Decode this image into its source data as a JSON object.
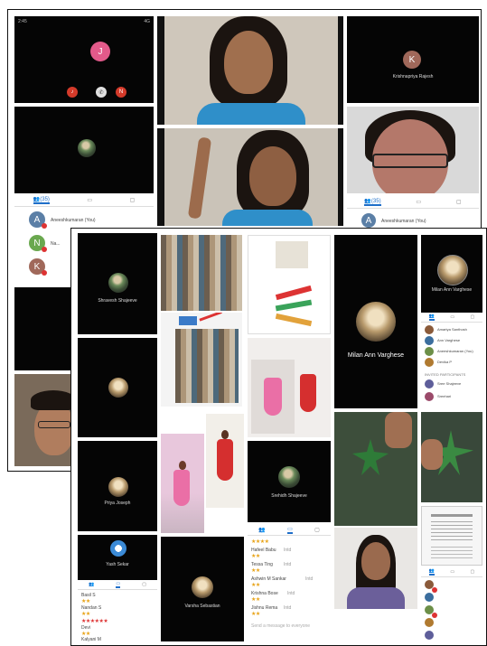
{
  "back_screenshot": {
    "status_bar": {
      "time": "2:45",
      "right": "4G"
    },
    "call_tile": {
      "caller_initial": "J",
      "controls": [
        "♪",
        "✆",
        "N"
      ]
    },
    "participant_tiles": [
      {
        "initial": "K",
        "name": "Krishnapriya Rajesh"
      }
    ],
    "tabs": [
      {
        "label": "(35)",
        "icon": "people-icon"
      },
      {
        "label": "",
        "icon": "chat-icon"
      },
      {
        "label": "",
        "icon": "info-icon"
      }
    ],
    "right_tabs": [
      {
        "label": "(35)",
        "icon": "people-icon"
      },
      {
        "label": "",
        "icon": "chat-icon"
      },
      {
        "label": "",
        "icon": "video-icon"
      }
    ],
    "participants": [
      {
        "initial": "A",
        "name": "Aneeshkumaran (You)",
        "color": "#5b7fa6"
      },
      {
        "initial": "N",
        "name": "Na...",
        "color": "#6aa84f"
      },
      {
        "initial": "K",
        "name": "",
        "color": "#a0685a"
      }
    ],
    "right_participant": {
      "initial": "A",
      "name": "Aneeshkumaran (You)"
    }
  },
  "front_screenshot": {
    "tiles": [
      {
        "name": "Shravesh Shajeeve"
      },
      {
        "name": ""
      },
      {
        "name": "Priya Joseph"
      },
      {
        "name": "Yash Sekar"
      },
      {
        "name": "Varsha Sebastian"
      },
      {
        "name": "Srehidh Shajeeve"
      },
      {
        "name": "Milan Ann Varghese"
      },
      {
        "name": "Milan Ann Varghese"
      }
    ],
    "chat_list": [
      {
        "name": "Hafeel Babu",
        "sub": "Intd",
        "stars": "★★"
      },
      {
        "name": "Tessa Ting",
        "sub": "Intd",
        "stars": "★★"
      },
      {
        "name": "Ashwin M Sankar",
        "sub": "Intd",
        "stars": "★★"
      },
      {
        "name": "Krishna Bose",
        "sub": "Intd",
        "stars": "★★"
      },
      {
        "name": "Jishnu Rema",
        "sub": "Intd",
        "stars": "★★"
      }
    ],
    "left_list": [
      {
        "name": "Basil S",
        "sub": "",
        "stars": "★★"
      },
      {
        "name": "Nandan S",
        "sub": "",
        "stars": "★★"
      },
      {
        "name": "Aswathy",
        "sub": "",
        "stars": "★★★★★★"
      },
      {
        "name": "Devi",
        "sub": "",
        "stars": "★★"
      },
      {
        "name": "Kalyani M",
        "sub": "",
        "stars": ""
      }
    ],
    "rating_top": "★★★★",
    "right_list": [
      {
        "name": "Amartya Santhosh",
        "color": "#8a5a3a"
      },
      {
        "name": "Ann Varghese",
        "color": "#3b6e9e"
      },
      {
        "name": "Aneeshkumaran (You)",
        "color": "#6c8f48"
      },
      {
        "name": "Devika P",
        "color": "#b07a30"
      },
      {
        "name": "Sree Shajeeve",
        "color": "#5e5e9a"
      },
      {
        "name": "Sreehari",
        "color": "#9b4a6a"
      }
    ],
    "right_section": "INVITED PARTICIPANTS",
    "footer_hint": "Send a message to everyone",
    "colors": {
      "accent": "#1f6fc9",
      "badge": "#d33333",
      "tile_bg": "#050505"
    }
  }
}
